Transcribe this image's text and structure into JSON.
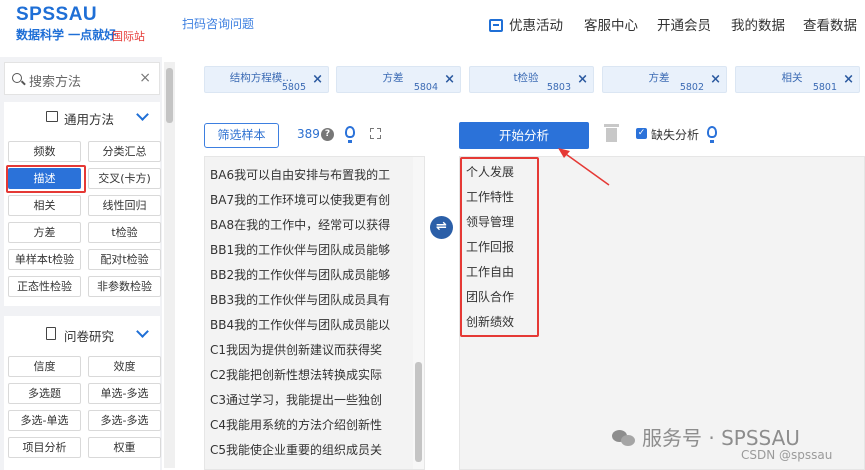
{
  "header": {
    "logo": "SPSSAU",
    "slogan": "数据科学 一点就好",
    "intl": "国际站",
    "scan_link": "扫码咨询问题",
    "nav": [
      "优惠活动",
      "客服中心",
      "开通会员",
      "我的数据",
      "查看数据"
    ]
  },
  "sidebar": {
    "search_placeholder": "搜索方法",
    "close": "×",
    "groups": [
      {
        "title": "通用方法",
        "items": [
          "频数",
          "分类汇总",
          "描述",
          "交叉(卡方)",
          "相关",
          "线性回归",
          "方差",
          "t检验",
          "单样本t检验",
          "配对t检验",
          "正态性检验",
          "非参数检验"
        ],
        "active": "描述"
      },
      {
        "title": "问卷研究",
        "items": [
          "信度",
          "效度",
          "多选题",
          "单选-多选",
          "多选-单选",
          "多选-多选",
          "项目分析",
          "权重"
        ]
      }
    ]
  },
  "tabs": [
    {
      "label": "结构方程模...",
      "num": "5805"
    },
    {
      "label": "方差",
      "num": "5804"
    },
    {
      "label": "t检验",
      "num": "5803"
    },
    {
      "label": "方差",
      "num": "5802"
    },
    {
      "label": "相关",
      "num": "5801"
    }
  ],
  "toolbar": {
    "filter_label": "筛选样本",
    "sample_count": "389",
    "help": "?",
    "start_label": "开始分析",
    "missing_label": "缺失分析",
    "missing_checked": true
  },
  "variables": [
    "BA6我可以自由安排与布置我的工",
    "BA7我的工作环境可以使我更有创",
    "BA8在我的工作中，经常可以获得",
    "BB1我的工作伙伴与团队成员能够",
    "BB2我的工作伙伴与团队成员能够",
    "BB3我的工作伙伴与团队成员具有",
    "BB4我的工作伙伴与团队成员能以",
    "C1我因为提供创新建议而获得奖",
    "C2我能把创新性想法转换成实际",
    "C3通过学习，我能提出一些独创",
    "C4我能用系统的方法介绍创新性",
    "C5我能使企业重要的组织成员关"
  ],
  "selected": [
    "个人发展",
    "工作特性",
    "领导管理",
    "工作回报",
    "工作自由",
    "团队合作",
    "创新绩效"
  ],
  "watermark": {
    "main": "服务号 · SPSSAU",
    "sub": "CSDN @spssau"
  },
  "colors": {
    "brand": "#1f6fd6",
    "primary_button": "#2b72d9",
    "highlight_box": "#e53935",
    "tab_bg": "#e9f1fb"
  }
}
